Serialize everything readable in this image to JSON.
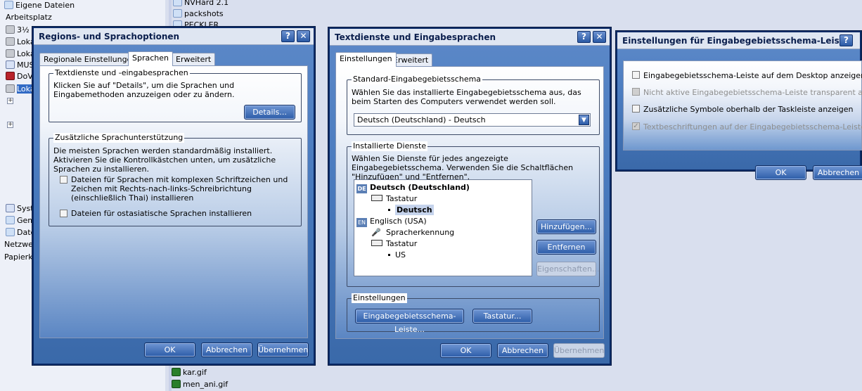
{
  "explorer": {
    "left_items": [
      "Eigene Dateien",
      "Arbeitsplatz",
      "3½",
      "Loka",
      "Loka",
      "MUS",
      "DoV",
      "Loka",
      "Syst",
      "Gem",
      "Date",
      "Netzwe",
      "Papierko"
    ],
    "right_items": [
      "NVHard 2.1",
      "packshots",
      "PECKLER",
      "kar.gif",
      "men_ani.gif"
    ]
  },
  "win1": {
    "title": "Regions- und Sprachoptionen",
    "tabs": [
      "Regionale Einstellungen",
      "Sprachen",
      "Erweitert"
    ],
    "group1_label": "Textdienste und -eingabesprachen",
    "group1_text": "Klicken Sie auf \"Details\", um die Sprachen und Eingabemethoden anzuzeigen oder zu ändern.",
    "details_btn": "Details...",
    "group2_label": "Zusätzliche Sprachunterstützung",
    "group2_text": "Die meisten Sprachen werden standardmäßig installiert. Aktivieren Sie die Kontrollkästchen unten, um zusätzliche Sprachen zu installieren.",
    "check1": "Dateien für Sprachen mit komplexen Schriftzeichen und Zeichen mit Rechts-nach-links-Schreibrichtung (einschließlich Thai) installieren",
    "check2": "Dateien für ostasiatische Sprachen installieren",
    "ok": "OK",
    "cancel": "Abbrechen",
    "apply": "Übernehmen"
  },
  "win2": {
    "title": "Textdienste und Eingabesprachen",
    "tabs": [
      "Einstellungen",
      "Erweitert"
    ],
    "std_label": "Standard-Eingabegebietsschema",
    "std_text": "Wählen Sie das installierte Eingabegebietsschema aus, das beim Starten des Computers verwendet werden soll.",
    "combo_value": "Deutsch (Deutschland) - Deutsch",
    "inst_label": "Installierte Dienste",
    "inst_text": "Wählen Sie Dienste für jedes angezeigte Eingabegebietsschema. Verwenden Sie die Schaltflächen \"Hinzufügen\" und \"Entfernen\".",
    "tree": {
      "de_code": "DE",
      "de_name": "Deutsch (Deutschland)",
      "de_kb": "Tastatur",
      "de_kb_layout": "Deutsch",
      "en_code": "EN",
      "en_name": "Englisch (USA)",
      "en_speech": "Spracherkennung",
      "en_kb": "Tastatur",
      "en_kb_layout": "US"
    },
    "add_btn": "Hinzufügen...",
    "remove_btn": "Entfernen",
    "props_btn": "Eigenschaften...",
    "settings_label": "Einstellungen",
    "langbar_btn": "Eingabegebietsschema-Leiste...",
    "keyboard_btn": "Tastatur...",
    "ok": "OK",
    "cancel": "Abbrechen",
    "apply": "Übernehmen"
  },
  "win3": {
    "title": "Einstellungen für Eingabegebietsschema-Leiste",
    "opt1": "Eingabegebietsschema-Leiste auf dem Desktop anzeigen",
    "opt2": "Nicht aktive Eingabegebietsschema-Leiste transparent anzeigen",
    "opt3": "Zusätzliche Symbole oberhalb der Taskleiste anzeigen",
    "opt4": "Textbeschriftungen auf der Eingabegebietsschema-Leiste anzeigen",
    "ok": "OK",
    "cancel": "Abbrechen"
  },
  "colors": {
    "accent": "#3f72b6",
    "title_text": "#0b1f4d",
    "button": "#2c5ca8"
  },
  "icons": [
    "help-icon",
    "close-icon",
    "folder-icon",
    "drive-icon",
    "keyboard-icon",
    "microphone-icon",
    "dropdown-arrow-icon"
  ]
}
